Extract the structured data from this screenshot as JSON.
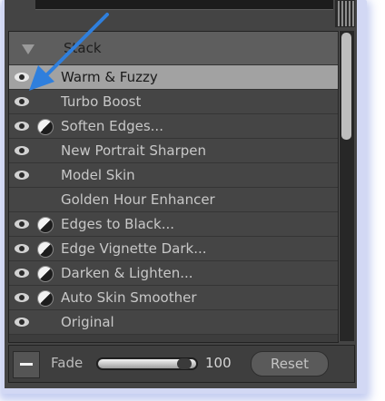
{
  "stack_panel": {
    "title": "Stack",
    "items": [
      {
        "label": "Warm & Fuzzy",
        "visible": true,
        "brush_icon": false,
        "selected": true
      },
      {
        "label": "Turbo Boost",
        "visible": true,
        "brush_icon": false,
        "selected": false
      },
      {
        "label": "Soften Edges...",
        "visible": true,
        "brush_icon": true,
        "selected": false
      },
      {
        "label": "New Portrait Sharpen",
        "visible": true,
        "brush_icon": false,
        "selected": false
      },
      {
        "label": "Model Skin",
        "visible": true,
        "brush_icon": false,
        "selected": false
      },
      {
        "label": "Golden Hour Enhancer",
        "visible": false,
        "brush_icon": false,
        "selected": false
      },
      {
        "label": "Edges to Black...",
        "visible": true,
        "brush_icon": true,
        "selected": false
      },
      {
        "label": "Edge Vignette Dark...",
        "visible": true,
        "brush_icon": true,
        "selected": false
      },
      {
        "label": "Darken & Lighten...",
        "visible": true,
        "brush_icon": true,
        "selected": false
      },
      {
        "label": "Auto Skin Smoother",
        "visible": true,
        "brush_icon": true,
        "selected": false
      },
      {
        "label": "Original",
        "visible": true,
        "brush_icon": false,
        "selected": false
      }
    ]
  },
  "fade": {
    "label": "Fade",
    "value": "100",
    "fraction": 1.0,
    "reset_label": "Reset"
  },
  "icons": {
    "visibility": "eye-icon",
    "brush": "brush-mask-icon",
    "collapse": "triangle-down-icon",
    "remove": "minus-icon",
    "annotation": "arrow-annotation"
  },
  "colors": {
    "panel_bg": "#444444",
    "selected_row": "#a2a2a2",
    "arrow": "#2f7fdd",
    "glow": "#d2d8f4"
  }
}
